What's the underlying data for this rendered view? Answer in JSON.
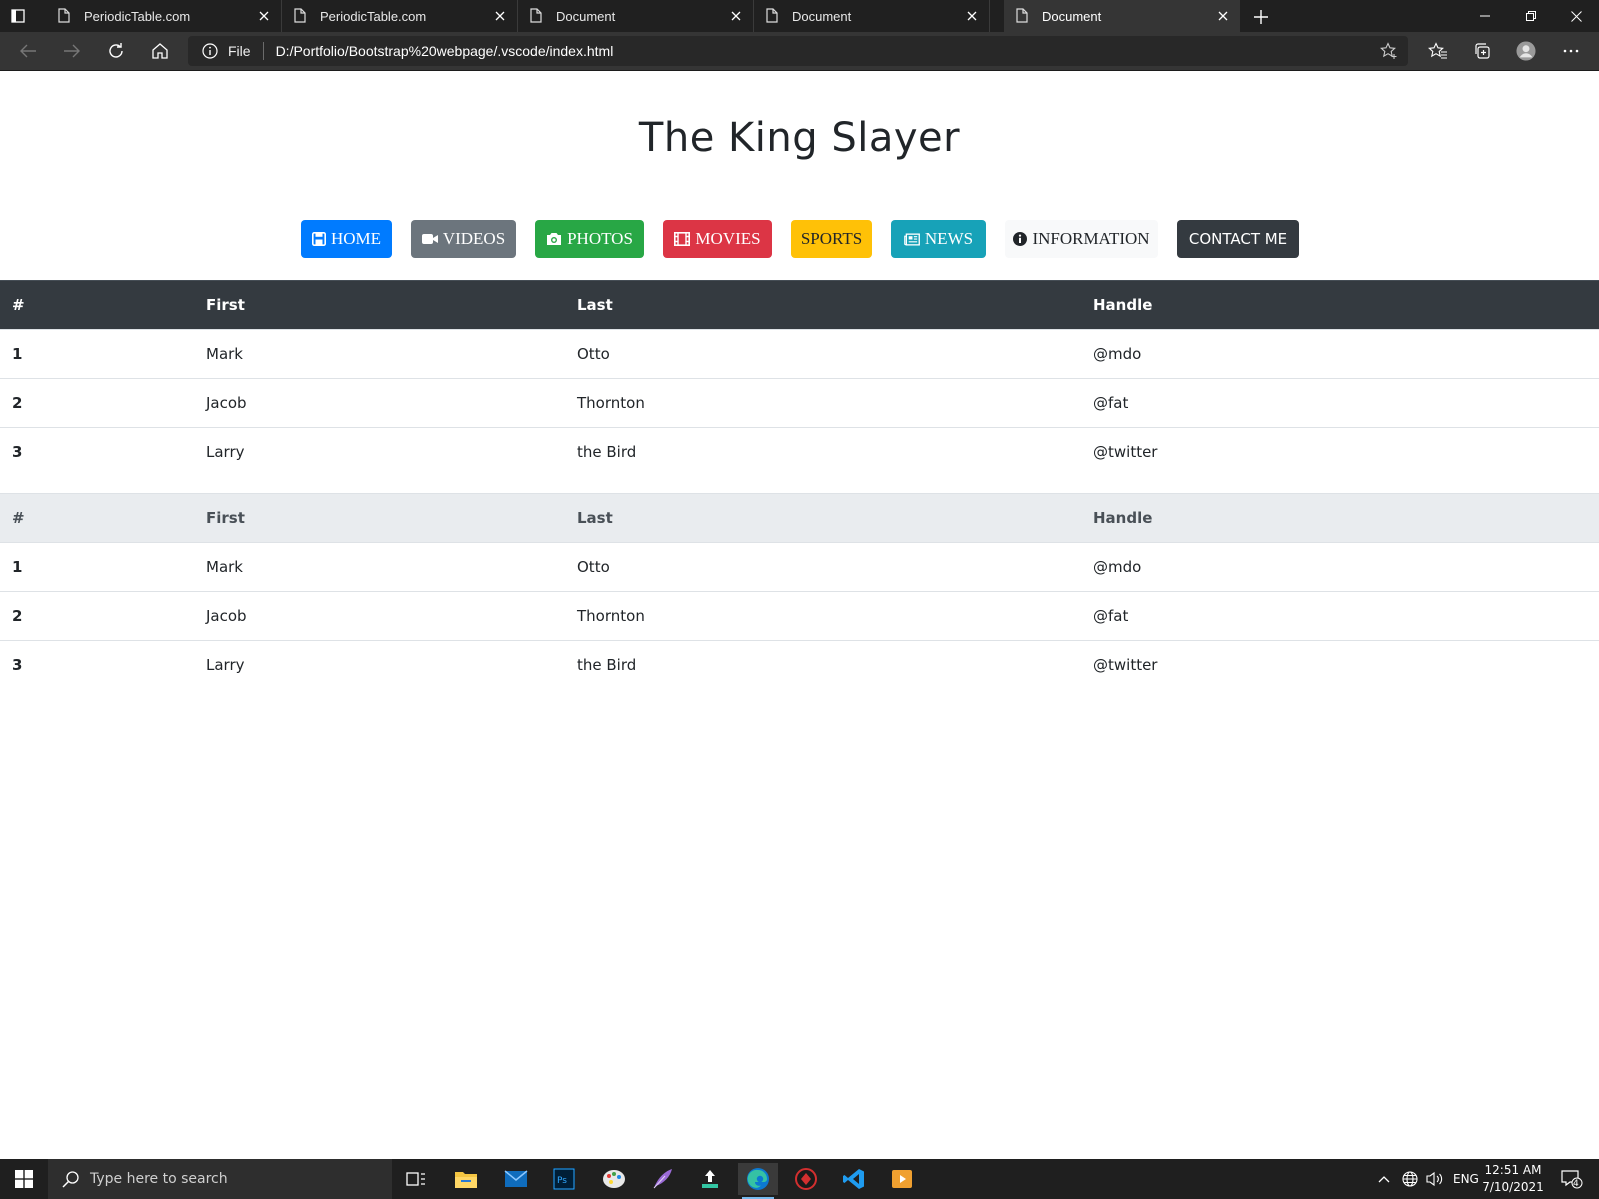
{
  "browser": {
    "tabs": [
      {
        "title": "PeriodicTable.com",
        "active": false
      },
      {
        "title": "PeriodicTable.com",
        "active": false
      },
      {
        "title": "Document",
        "active": false
      },
      {
        "title": "Document",
        "active": false
      },
      {
        "title": "Document",
        "active": true
      }
    ],
    "address": {
      "scheme": "File",
      "url": "D:/Portfolio/Bootstrap%20webpage/.vscode/index.html"
    }
  },
  "page": {
    "title": "The King Slayer",
    "nav": [
      {
        "label": "HOME",
        "icon": "save-icon",
        "style": "primary",
        "color": "#007bff"
      },
      {
        "label": "VIDEOS",
        "icon": "video-camera-icon",
        "style": "secondary",
        "color": "#6c757d"
      },
      {
        "label": "PHOTOS",
        "icon": "camera-icon",
        "style": "success",
        "color": "#28a745"
      },
      {
        "label": "MOVIES",
        "icon": "film-icon",
        "style": "danger",
        "color": "#dc3545"
      },
      {
        "label": "SPORTS",
        "icon": "",
        "style": "warning",
        "color": "#ffc107"
      },
      {
        "label": "NEWS",
        "icon": "newspaper-icon",
        "style": "info",
        "color": "#17a2b8"
      },
      {
        "label": "INFORMATION",
        "icon": "info-circle-icon",
        "style": "light",
        "color": "#f8f9fa"
      },
      {
        "label": "CONTACT ME",
        "icon": "",
        "style": "dark",
        "color": "#343a40"
      }
    ],
    "tables": [
      {
        "theme": "dark",
        "headers": [
          "#",
          "First",
          "Last",
          "Handle"
        ],
        "rows": [
          [
            "1",
            "Mark",
            "Otto",
            "@mdo"
          ],
          [
            "2",
            "Jacob",
            "Thornton",
            "@fat"
          ],
          [
            "3",
            "Larry",
            "the Bird",
            "@twitter"
          ]
        ]
      },
      {
        "theme": "light",
        "headers": [
          "#",
          "First",
          "Last",
          "Handle"
        ],
        "rows": [
          [
            "1",
            "Mark",
            "Otto",
            "@mdo"
          ],
          [
            "2",
            "Jacob",
            "Thornton",
            "@fat"
          ],
          [
            "3",
            "Larry",
            "the Bird",
            "@twitter"
          ]
        ]
      }
    ]
  },
  "taskbar": {
    "search_placeholder": "Type here to search",
    "apps": [
      "task-view-icon",
      "file-explorer-icon",
      "mail-icon",
      "photoshop-icon",
      "paint-icon",
      "feather-icon",
      "upload-app-icon",
      "edge-icon",
      "game-icon",
      "vscode-icon",
      "media-player-icon"
    ],
    "language": "ENG",
    "time": "12:51 AM",
    "date": "7/10/2021",
    "notification_count": "4"
  }
}
